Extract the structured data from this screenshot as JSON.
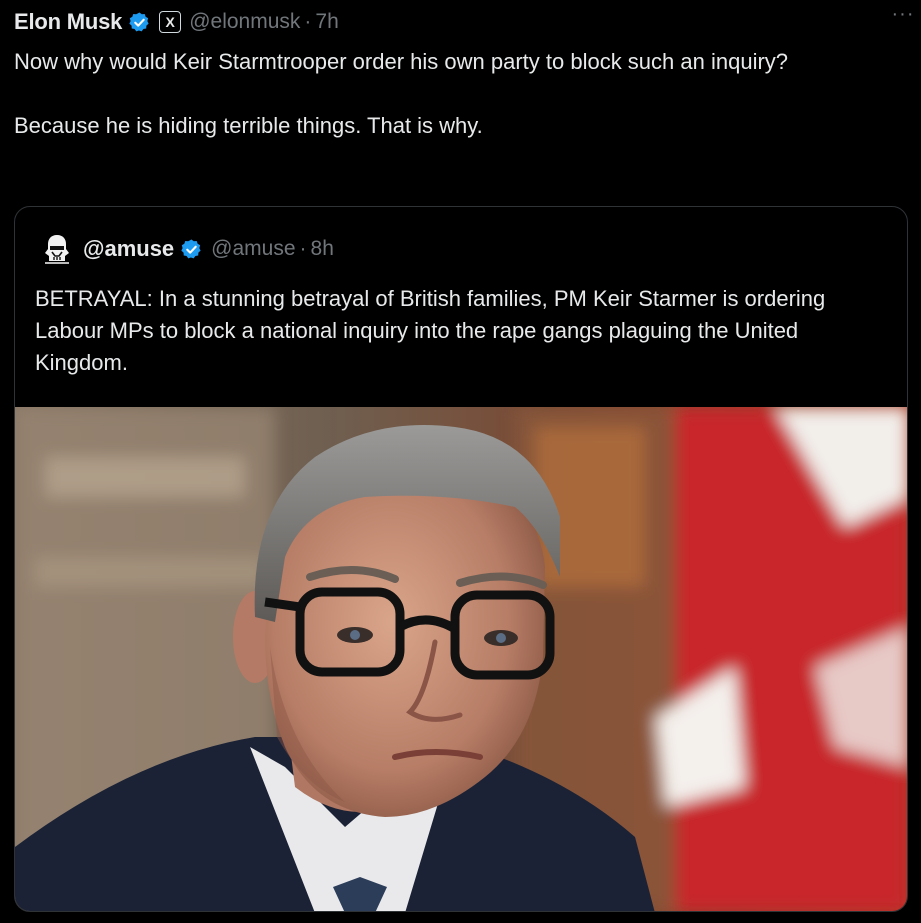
{
  "post": {
    "author_name": "Elon Musk",
    "affiliation_badge": "X",
    "handle": "@elonmusk",
    "separator": "·",
    "time": "7h",
    "more_label": "···",
    "text": "Now why would Keir Starmtrooper order his own party to block such an inquiry?\n\nBecause he is hiding terrible things. That is why."
  },
  "quote": {
    "author_name": "@amuse",
    "handle": "@amuse",
    "separator": "·",
    "time": "8h",
    "text": "BETRAYAL: In a stunning betrayal of British families, PM Keir Starmer is ordering Labour MPs to block a national inquiry into the rape gangs plaguing the United Kingdom.",
    "media": {
      "kind": "photo",
      "subject": "portrait of a grey-haired man wearing dark glasses, dark suit and white shirt, red and white flag in the background"
    }
  },
  "icons": {
    "verified": "verified-badge-icon",
    "avatar": "stormtrooper-avatar-icon",
    "more": "more-options-icon"
  },
  "colors": {
    "background": "#000000",
    "text_primary": "#e7e9ea",
    "text_secondary": "#71767b",
    "verified_blue": "#1d9bf0",
    "border": "#2f3336"
  }
}
